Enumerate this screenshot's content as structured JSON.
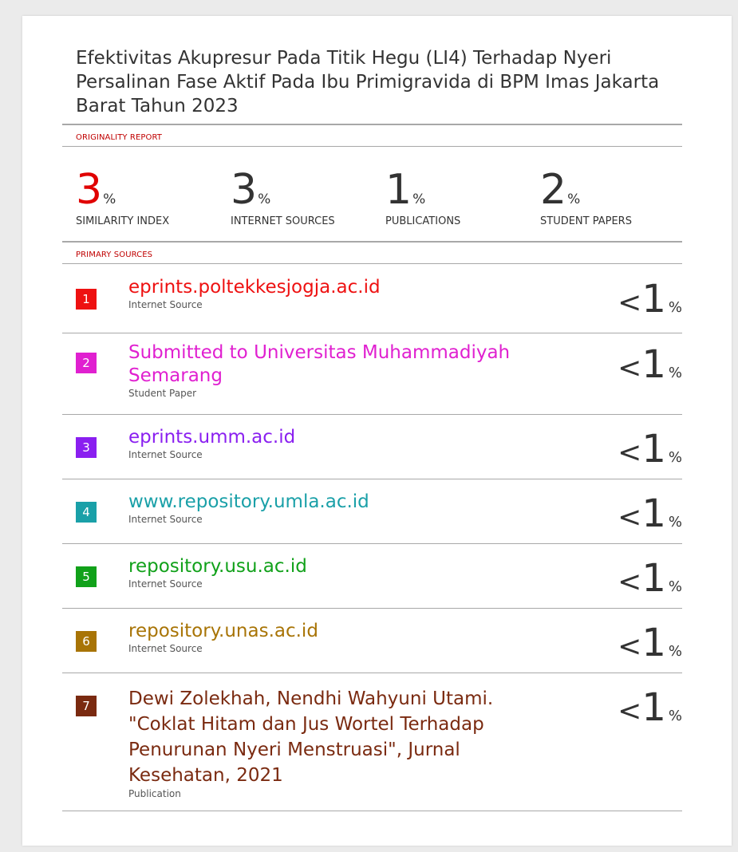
{
  "title": "Efektivitas Akupresur Pada Titik Hegu (LI4) Terhadap Nyeri Persalinan Fase Aktif Pada Ibu Primigravida di BPM Imas Jakarta Barat Tahun 2023",
  "originality_label": "ORIGINALITY REPORT",
  "stats": [
    {
      "value": "3",
      "unit": "%",
      "label": "SIMILARITY INDEX"
    },
    {
      "value": "3",
      "unit": "%",
      "label": "INTERNET SOURCES"
    },
    {
      "value": "1",
      "unit": "%",
      "label": "PUBLICATIONS"
    },
    {
      "value": "2",
      "unit": "%",
      "label": "STUDENT PAPERS"
    }
  ],
  "primary_label": "PRIMARY SOURCES",
  "sources": [
    {
      "rank": "1",
      "name": "eprints.poltekkesjogja.ac.id",
      "type": "Internet Source",
      "lt": "<",
      "value": "1",
      "unit": "%",
      "color": "#ee1111"
    },
    {
      "rank": "2",
      "name": "Submitted to Universitas Muhammadiyah Semarang",
      "type": "Student Paper",
      "lt": "<",
      "value": "1",
      "unit": "%",
      "color": "#e020d0"
    },
    {
      "rank": "3",
      "name": "eprints.umm.ac.id",
      "type": "Internet Source",
      "lt": "<",
      "value": "1",
      "unit": "%",
      "color": "#8a1ff0"
    },
    {
      "rank": "4",
      "name": "www.repository.umla.ac.id",
      "type": "Internet Source",
      "lt": "<",
      "value": "1",
      "unit": "%",
      "color": "#1aa0a8"
    },
    {
      "rank": "5",
      "name": "repository.usu.ac.id",
      "type": "Internet Source",
      "lt": "<",
      "value": "1",
      "unit": "%",
      "color": "#11a11a"
    },
    {
      "rank": "6",
      "name": "repository.unas.ac.id",
      "type": "Internet Source",
      "lt": "<",
      "value": "1",
      "unit": "%",
      "color": "#a87406"
    },
    {
      "rank": "7",
      "name": "Dewi Zolekhah, Nendhi Wahyuni Utami. \"Coklat Hitam dan Jus Wortel Terhadap Penurunan Nyeri Menstruasi\", Jurnal Kesehatan, 2021",
      "type": "Publication",
      "lt": "<",
      "value": "1",
      "unit": "%",
      "color": "#7a2a10"
    }
  ]
}
